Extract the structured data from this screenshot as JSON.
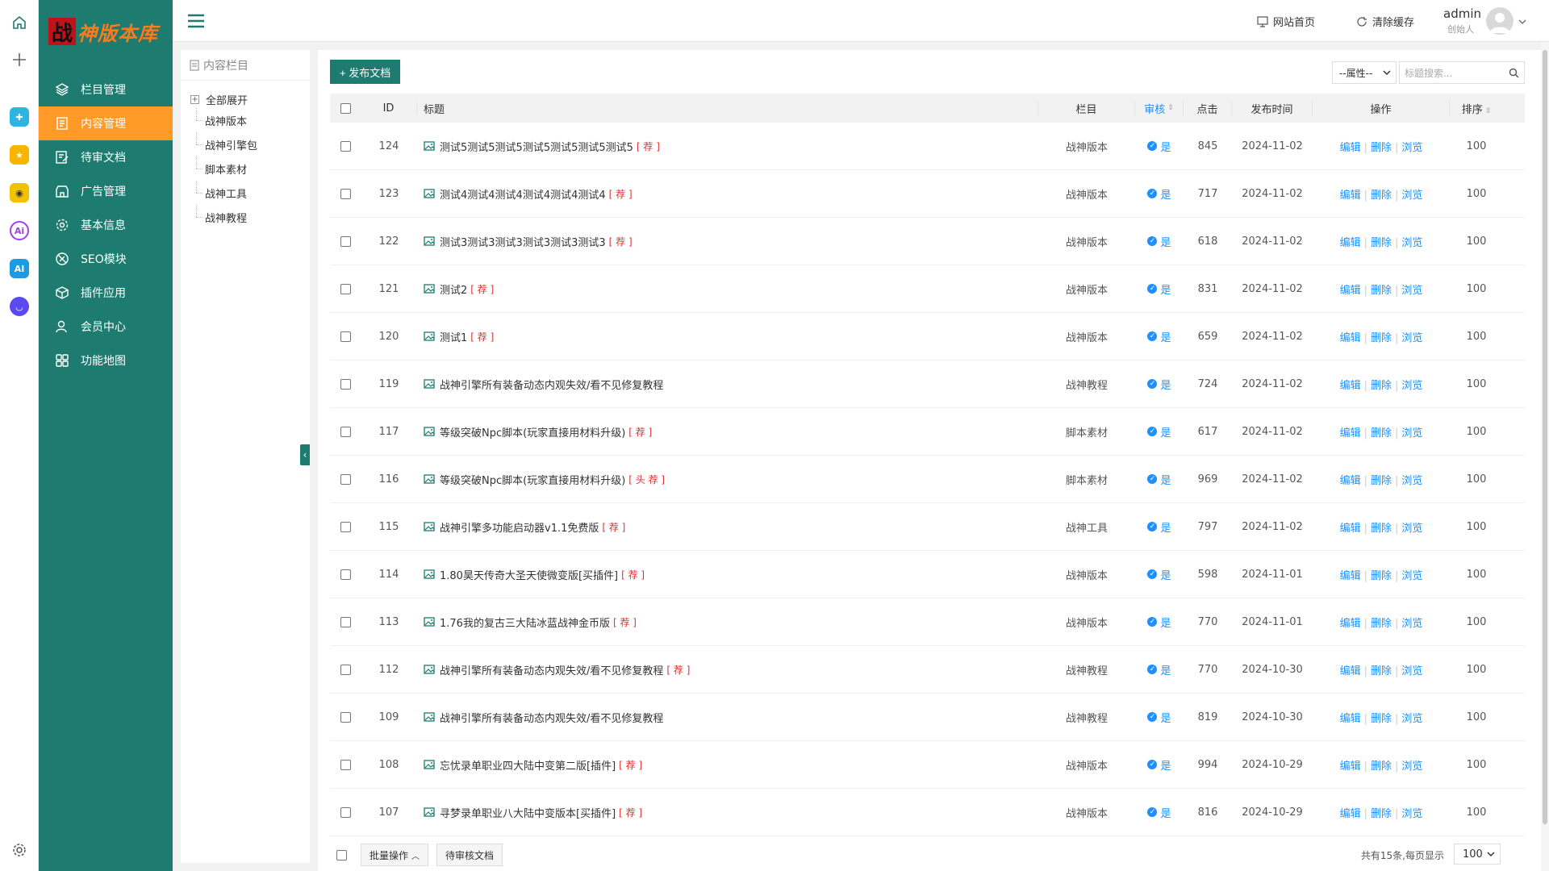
{
  "app_strip": {
    "icons": [
      "home-icon",
      "plus-icon",
      "app-blue-icon",
      "app-star-icon",
      "app-robot-icon",
      "app-ai-ring-icon",
      "app-ai-icon",
      "app-chat-icon",
      "settings-icon"
    ]
  },
  "sidebar": {
    "logo_mark": "战",
    "logo_text": "神版本库",
    "items": [
      {
        "label": "栏目管理",
        "icon": "layers-icon",
        "active": false
      },
      {
        "label": "内容管理",
        "icon": "document-icon",
        "active": true
      },
      {
        "label": "待审文档",
        "icon": "edit-doc-icon",
        "active": false
      },
      {
        "label": "广告管理",
        "icon": "store-icon",
        "active": false
      },
      {
        "label": "基本信息",
        "icon": "gear-icon",
        "active": false
      },
      {
        "label": "SEO模块",
        "icon": "seo-icon",
        "active": false
      },
      {
        "label": "插件应用",
        "icon": "cube-icon",
        "active": false
      },
      {
        "label": "会员中心",
        "icon": "user-icon",
        "active": false
      },
      {
        "label": "功能地图",
        "icon": "grid-icon",
        "active": false
      }
    ]
  },
  "topbar": {
    "site_home": "网站首页",
    "clear_cache": "清除缓存",
    "user_name": "admin",
    "user_role": "创始人"
  },
  "tree": {
    "header": "内容栏目",
    "root": "全部展开",
    "children": [
      "战神版本",
      "战神引擎包",
      "脚本素材",
      "战神工具",
      "战神教程"
    ]
  },
  "toolbar": {
    "publish": "+ 发布文档",
    "attr_select": "--属性--",
    "search_placeholder": "标题搜索..."
  },
  "table": {
    "headers": {
      "id": "ID",
      "title": "标题",
      "column": "栏目",
      "audit": "审核",
      "clicks": "点击",
      "date": "发布时间",
      "ops": "操作",
      "sort": "排序"
    },
    "ops": {
      "edit": "编辑",
      "delete": "删除",
      "view": "浏览"
    },
    "rows": [
      {
        "id": "124",
        "title": "测试5测试5测试5测试5测试5测试5测试5",
        "tag": "[ 荐 ]",
        "column": "战神版本",
        "audit": "是",
        "clicks": "845",
        "date": "2024-11-02",
        "sort": "100"
      },
      {
        "id": "123",
        "title": "测试4测试4测试4测试4测试4测试4",
        "tag": "[ 荐 ]",
        "column": "战神版本",
        "audit": "是",
        "clicks": "717",
        "date": "2024-11-02",
        "sort": "100"
      },
      {
        "id": "122",
        "title": "测试3测试3测试3测试3测试3测试3",
        "tag": "[ 荐 ]",
        "column": "战神版本",
        "audit": "是",
        "clicks": "618",
        "date": "2024-11-02",
        "sort": "100"
      },
      {
        "id": "121",
        "title": "测试2",
        "tag": "[ 荐 ]",
        "column": "战神版本",
        "audit": "是",
        "clicks": "831",
        "date": "2024-11-02",
        "sort": "100"
      },
      {
        "id": "120",
        "title": "测试1",
        "tag": "[ 荐 ]",
        "column": "战神版本",
        "audit": "是",
        "clicks": "659",
        "date": "2024-11-02",
        "sort": "100"
      },
      {
        "id": "119",
        "title": "战神引擎所有装备动态内观失效/看不见修复教程",
        "tag": "",
        "column": "战神教程",
        "audit": "是",
        "clicks": "724",
        "date": "2024-11-02",
        "sort": "100"
      },
      {
        "id": "117",
        "title": "等级突破Npc脚本(玩家直接用材料升级)",
        "tag": "[ 荐 ]",
        "column": "脚本素材",
        "audit": "是",
        "clicks": "617",
        "date": "2024-11-02",
        "sort": "100"
      },
      {
        "id": "116",
        "title": "等级突破Npc脚本(玩家直接用材料升级)",
        "tag": "[ 头 荐 ]",
        "column": "脚本素材",
        "audit": "是",
        "clicks": "969",
        "date": "2024-11-02",
        "sort": "100"
      },
      {
        "id": "115",
        "title": "战神引擎多功能启动器v1.1免费版",
        "tag": "[ 荐 ]",
        "column": "战神工具",
        "audit": "是",
        "clicks": "797",
        "date": "2024-11-02",
        "sort": "100"
      },
      {
        "id": "114",
        "title": "1.80昊天传奇大圣天使微变版[买插件]",
        "tag": "[ 荐 ]",
        "column": "战神版本",
        "audit": "是",
        "clicks": "598",
        "date": "2024-11-01",
        "sort": "100"
      },
      {
        "id": "113",
        "title": "1.76我的复古三大陆冰蓝战神金币版",
        "tag": "[ 荐 ]",
        "column": "战神版本",
        "audit": "是",
        "clicks": "770",
        "date": "2024-11-01",
        "sort": "100"
      },
      {
        "id": "112",
        "title": "战神引擎所有装备动态内观失效/看不见修复教程",
        "tag": "[ 荐 ]",
        "column": "战神教程",
        "audit": "是",
        "clicks": "770",
        "date": "2024-10-30",
        "sort": "100"
      },
      {
        "id": "109",
        "title": "战神引擎所有装备动态内观失效/看不见修复教程",
        "tag": "",
        "column": "战神教程",
        "audit": "是",
        "clicks": "819",
        "date": "2024-10-30",
        "sort": "100"
      },
      {
        "id": "108",
        "title": "忘忧录单职业四大陆中变第二版[插件]",
        "tag": "[ 荐 ]",
        "column": "战神版本",
        "audit": "是",
        "clicks": "994",
        "date": "2024-10-29",
        "sort": "100"
      },
      {
        "id": "107",
        "title": "寻梦录单职业八大陆中变版本[买插件]",
        "tag": "[ 荐 ]",
        "column": "战神版本",
        "audit": "是",
        "clicks": "816",
        "date": "2024-10-29",
        "sort": "100"
      }
    ]
  },
  "footer": {
    "batch": "批量操作",
    "pending": "待审核文档",
    "page_info": "共有15条,每页显示",
    "page_size": "100"
  },
  "colors": {
    "sidebar_bg": "#1e7b6f",
    "active_bg": "#ff9a28",
    "link": "#1e90ff",
    "tag": "#e03030"
  }
}
